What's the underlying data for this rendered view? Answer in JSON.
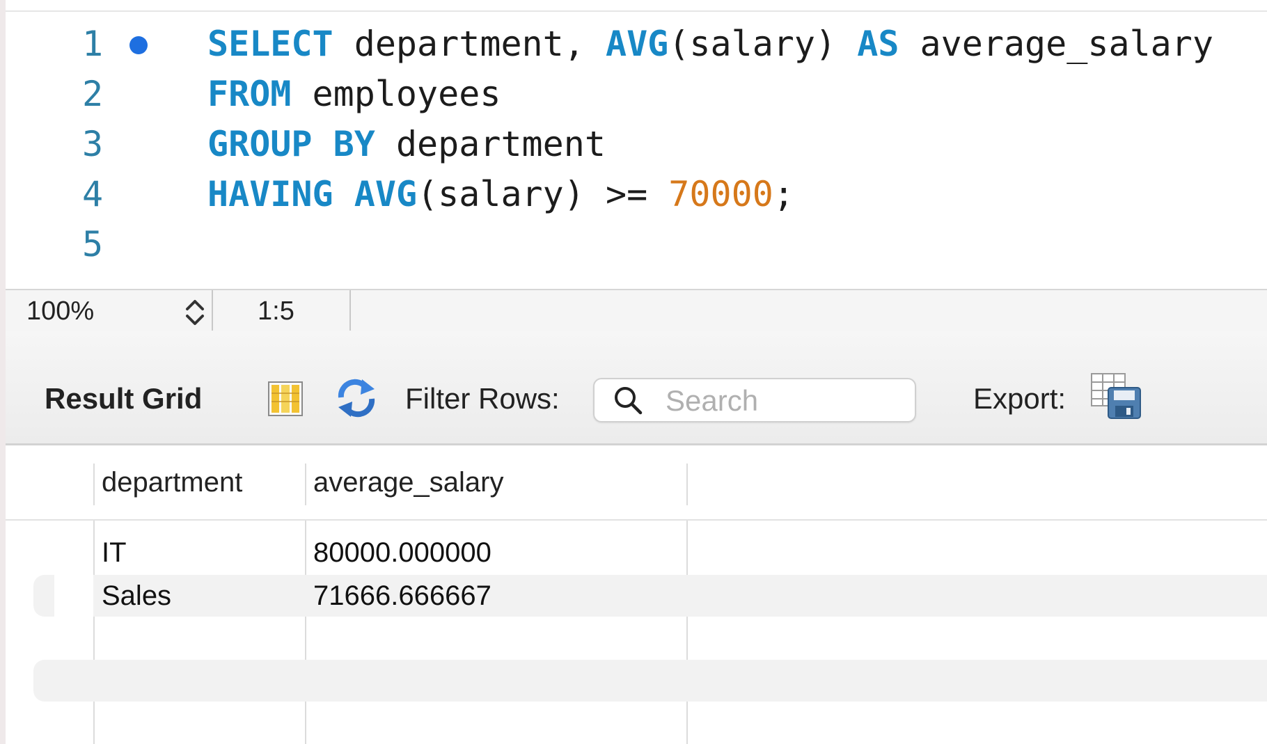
{
  "editor": {
    "lines": [
      {
        "num": "1",
        "has_dot": true
      },
      {
        "num": "2",
        "has_dot": false
      },
      {
        "num": "3",
        "has_dot": false
      },
      {
        "num": "4",
        "has_dot": false
      },
      {
        "num": "5",
        "has_dot": false
      }
    ],
    "code": {
      "l1_kw1": "SELECT",
      "l1_t1": " department, ",
      "l1_kw2": "AVG",
      "l1_t2": "(salary) ",
      "l1_kw3": "AS",
      "l1_t3": " average_salary",
      "l2_kw1": "FROM",
      "l2_t1": " employees",
      "l3_kw1": "GROUP",
      "l3_kw2": "BY",
      "l3_t1": " department",
      "l4_kw1": "HAVING",
      "l4_kw2": "AVG",
      "l4_t1": "(salary) >= ",
      "l4_num": "70000",
      "l4_t2": ";"
    },
    "colors": {
      "keyword": "#1888c6",
      "number": "#d6781a",
      "line_number": "#2d7fa6",
      "dot": "#1e6fe0"
    }
  },
  "status_bar": {
    "zoom": "100%",
    "cursor": "1:5"
  },
  "toolbar": {
    "result_grid_label": "Result Grid",
    "grid_icon": "grid-columns-icon",
    "refresh_icon": "refresh-icon",
    "filter_label": "Filter Rows:",
    "search_placeholder": "Search",
    "search_value": "",
    "export_label": "Export:",
    "export_icon": "export-save-icon"
  },
  "results": {
    "columns": [
      "department",
      "average_salary"
    ],
    "rows": [
      [
        "IT",
        "80000.000000"
      ],
      [
        "Sales",
        "71666.666667"
      ]
    ]
  }
}
